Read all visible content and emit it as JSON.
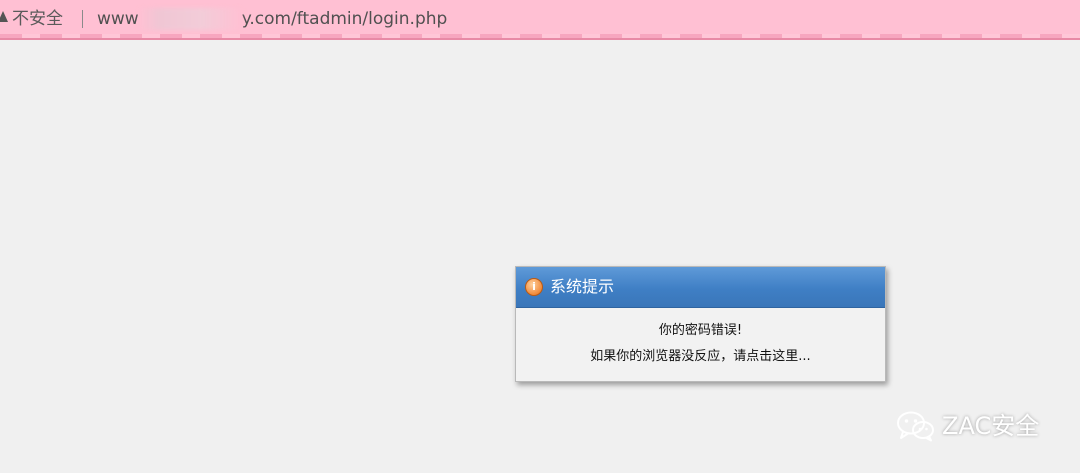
{
  "browser": {
    "security_icon": "warning-triangle-icon",
    "security_label": "不安全",
    "url_prefix": "www",
    "url_suffix": "y.com/ftadmin/login.php"
  },
  "dialog": {
    "title": "系统提示",
    "icon": "info-icon",
    "message": "你的密码错误!",
    "redirect_text": "如果你的浏览器没反应，请点击这里..."
  },
  "watermark": {
    "icon": "wechat-icon",
    "text": "ZAC安全"
  }
}
